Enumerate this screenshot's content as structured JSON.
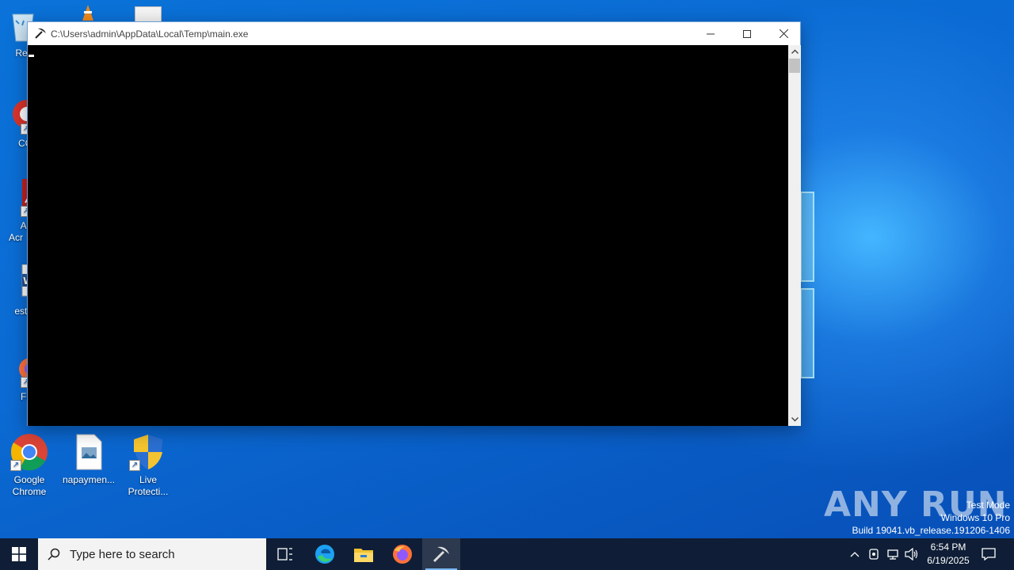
{
  "desktop": {
    "partial_icons": [
      {
        "label": "Recy"
      },
      {
        "label": "CCl"
      },
      {
        "label": "Ad\nAcr"
      },
      {
        "label": "estbl"
      },
      {
        "label": "Fir"
      }
    ],
    "icons": [
      {
        "label": "Google\nChrome",
        "icon": "chrome-icon"
      },
      {
        "label": "napaymen...",
        "icon": "image-file-icon"
      },
      {
        "label": "Live\nProtecti...",
        "icon": "uac-shield-icon"
      }
    ]
  },
  "window": {
    "title": "C:\\Users\\admin\\AppData\\Local\\Temp\\main.exe",
    "app_icon": "pickaxe-icon",
    "console_background": "#000000"
  },
  "watermark": {
    "brand": "ANY RUN",
    "line1": "Test Mode",
    "line2": "Windows 10 Pro",
    "line3": "Build 19041.vb_release.191206-1406"
  },
  "taskbar": {
    "search_placeholder": "Type here to search",
    "pinned": [
      "task-view-icon",
      "edge-icon",
      "file-explorer-icon",
      "firefox-icon",
      "pickaxe-app-icon"
    ],
    "time": "6:54 PM",
    "date": "6/19/2025",
    "color": "#0f1e36"
  }
}
